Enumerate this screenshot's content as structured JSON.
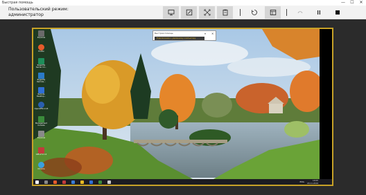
{
  "window": {
    "title": "Быстрая помощь",
    "minimize": "—",
    "maximize": "☐",
    "close": "✕"
  },
  "toolbar": {
    "mode_line1": "Пользовательский режим:",
    "mode_line2": "администратор"
  },
  "remote": {
    "desktop_icons": [
      {
        "label": "Корзина",
        "color": "#6a6a6a"
      },
      {
        "label": "Firefox",
        "color": "#e55b2b"
      },
      {
        "label": "Rogertify Server Co...",
        "color": "#1e8f5a"
      },
      {
        "label": "Rogertify Remote...",
        "color": "#2a7ac7"
      },
      {
        "label": "Remote Desktop...",
        "color": "#2f6fd6"
      },
      {
        "label": "OpenVPN 2.4.8",
        "color": "#2a5fb0"
      },
      {
        "label": "Management Console",
        "color": "#3b8c3b"
      },
      {
        "label": "Корзина",
        "color": "#8a8a8a"
      },
      {
        "label": "GPU-Z 2.1.0",
        "color": "#c23b3b"
      },
      {
        "label": "Chrome",
        "color": "#3aa0e0"
      }
    ],
    "widget": {
      "title": "Быстрая помощь",
      "bar_text": "Подключение к удаленному компьютеру",
      "pause": "⏸",
      "close": "✕"
    },
    "taskbar": {
      "lang": "ENG",
      "time": "19:05",
      "date": "20.11.2019"
    }
  },
  "colors": {
    "frame_border": "#c8a227",
    "background": "#2b2b2b",
    "toolbar": "#f2f2f2"
  },
  "icons": [
    "monitor-icon",
    "annotate-icon",
    "fit-screen-icon",
    "task-manager-icon",
    "restart-icon",
    "toggle-instruction-icon",
    "reconnect-icon",
    "pause-icon",
    "stop-icon"
  ]
}
